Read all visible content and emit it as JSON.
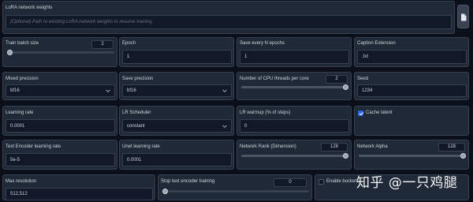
{
  "lora_weights": {
    "label": "LoRA network weights",
    "placeholder": "{Optional} Path to existing LoRA network weights to resume training"
  },
  "row1": {
    "train_batch_size": {
      "label": "Train batch size",
      "value": "2",
      "slider_fraction": 0.03
    },
    "epoch": {
      "label": "Epoch",
      "value": "1"
    },
    "save_every_n_epochs": {
      "label": "Save every N epochs",
      "value": "1"
    },
    "caption_extension": {
      "label": "Caption Extension",
      "value": ".txt"
    }
  },
  "row2": {
    "mixed_precision": {
      "label": "Mixed precision",
      "value": "bf16"
    },
    "save_precision": {
      "label": "Save precision",
      "value": "bf16"
    },
    "cpu_threads": {
      "label": "Number of CPU threads per core",
      "value": "2",
      "slider_fraction": 1.0
    },
    "seed": {
      "label": "Seed",
      "value": "1234"
    }
  },
  "row3": {
    "learning_rate": {
      "label": "Learning rate",
      "value": "0.0001"
    },
    "lr_scheduler": {
      "label": "LR Scheduler",
      "value": "constant"
    },
    "lr_warmup": {
      "label": "LR warmup (% of steps)",
      "value": "0"
    },
    "cache_latent": {
      "label": "Cache latent",
      "checked": true
    }
  },
  "row4": {
    "text_encoder_lr": {
      "label": "Text Encoder learning rate",
      "value": "5e-5"
    },
    "unet_lr": {
      "label": "Unet learning rate",
      "value": "0.0001"
    },
    "network_rank": {
      "label": "Network Rank (Dimension)",
      "value": "128",
      "slider_fraction": 1.0
    },
    "network_alpha": {
      "label": "Network Alpha",
      "value": "128",
      "slider_fraction": 1.0
    }
  },
  "row5": {
    "max_resolution": {
      "label": "Max resolution",
      "value": "512,512"
    },
    "stop_text_encoder": {
      "label": "Stop text encoder training",
      "value": "0",
      "slider_fraction": 0.0
    },
    "enable_buckets": {
      "label": "Enable buckets",
      "checked": false
    }
  },
  "icons": {
    "file_button": "document-icon"
  },
  "watermark": "知乎 @一只鸡腿"
}
